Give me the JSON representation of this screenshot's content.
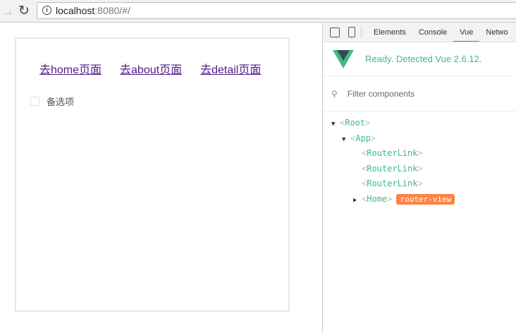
{
  "browser": {
    "url_host": "localhost",
    "url_rest": ":8080/#/"
  },
  "page": {
    "links": [
      "去home页面",
      "去about页面",
      "去detail页面"
    ],
    "checkbox_label": "备选项"
  },
  "devtools": {
    "tabs": [
      "Elements",
      "Console",
      "Vue",
      "Netwo"
    ],
    "active_tab": "Vue",
    "ready_text": "Ready. Detected Vue 2.6.12.",
    "filter_placeholder": "Filter components",
    "tree": [
      {
        "name": "Root"
      },
      {
        "name": "App"
      },
      {
        "name": "RouterLink"
      },
      {
        "name": "RouterLink"
      },
      {
        "name": "RouterLink"
      },
      {
        "name": "Home",
        "badge": "router-view"
      }
    ],
    "accent": "#42b983",
    "badge_color": "#ff8344"
  }
}
